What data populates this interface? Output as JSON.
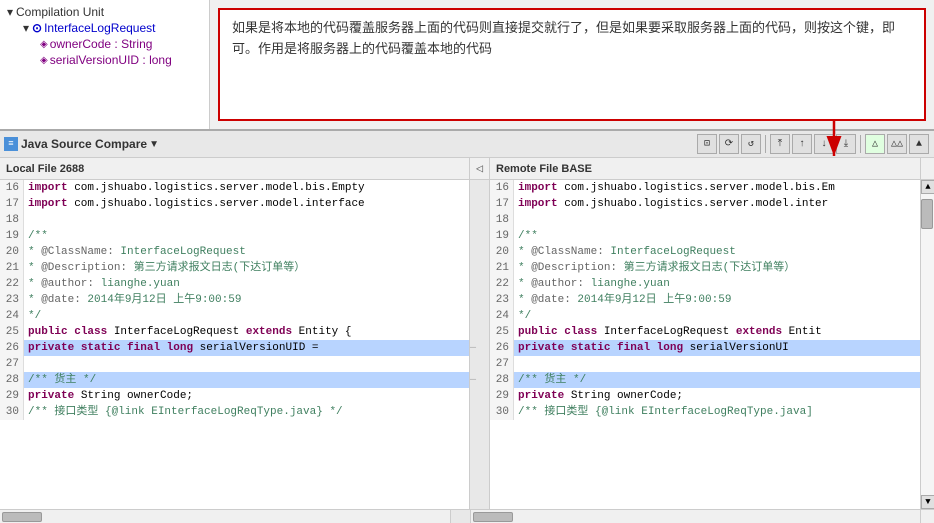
{
  "topPanel": {
    "tree": {
      "root": "Compilation Unit",
      "child": "InterfaceLogRequest",
      "grandchildren": [
        "ownerCode : String",
        "serialVersionUID : long"
      ]
    },
    "callout": "如果是将本地的代码覆盖服务器上面的代码则直接提交就行了，但是如果要采取服务器上面的代码，则按这个键，即可。作用是将服务器上的代码覆盖本地的代码"
  },
  "toolbar": {
    "title": "Java Source Compare",
    "dropdown_label": "▼",
    "buttons": [
      "⊡",
      "↺",
      "↻",
      "⤒",
      "↑",
      "↓",
      "⤓",
      "△",
      "△△",
      "▲"
    ]
  },
  "fileHeaders": {
    "left": "Local File 2688",
    "arrow": "◁",
    "right": "Remote File BASE"
  },
  "leftCode": [
    {
      "num": "16",
      "content": "import com.jshuabo.logistics.server.model.bis.Empty",
      "highlight": false
    },
    {
      "num": "17",
      "content": "import com.jshuabo.logistics.server.model.interface",
      "highlight": false
    },
    {
      "num": "18",
      "content": "",
      "highlight": false
    },
    {
      "num": "19",
      "content": "/**",
      "highlight": false
    },
    {
      "num": "20",
      "content": " * @ClassName: InterfaceLogRequest",
      "highlight": false
    },
    {
      "num": "21",
      "content": " * @Description: 第三方请求报文日志(下达订单等）",
      "highlight": false
    },
    {
      "num": "22",
      "content": " * @author: lianghe.yuan",
      "highlight": false
    },
    {
      "num": "23",
      "content": " * @date: 2014年9月12日 上午9:00:59",
      "highlight": false
    },
    {
      "num": "24",
      "content": " */",
      "highlight": false
    },
    {
      "num": "25",
      "content": "public class InterfaceLogRequest extends Entity {",
      "highlight": false
    },
    {
      "num": "26",
      "content": "    private static final long serialVersionUID =",
      "highlight": true
    },
    {
      "num": "27",
      "content": "",
      "highlight": false
    },
    {
      "num": "28",
      "content": "    /** 货主 */",
      "highlight": true
    },
    {
      "num": "29",
      "content": "    private String ownerCode;",
      "highlight": false
    },
    {
      "num": "30",
      "content": "    /** 接口类型 {@link EInterfaceLogReqType.java} */",
      "highlight": false
    }
  ],
  "rightCode": [
    {
      "num": "16",
      "content": "import com.jshuabo.logistics.server.model.bis.Em",
      "highlight": false
    },
    {
      "num": "17",
      "content": "import com.jshuabo.logistics.server.model.inter",
      "highlight": false
    },
    {
      "num": "18",
      "content": "",
      "highlight": false
    },
    {
      "num": "19",
      "content": "/**",
      "highlight": false
    },
    {
      "num": "20",
      "content": " * @ClassName: InterfaceLogRequest",
      "highlight": false
    },
    {
      "num": "21",
      "content": " * @Description: 第三方请求报文日志(下达订单等）",
      "highlight": false
    },
    {
      "num": "22",
      "content": " * @author: lianghe.yuan",
      "highlight": false
    },
    {
      "num": "23",
      "content": " * @date: 2014年9月12日 上午9:00:59",
      "highlight": false
    },
    {
      "num": "24",
      "content": " */",
      "highlight": false
    },
    {
      "num": "25",
      "content": "public class InterfaceLogRequest extends Entit",
      "highlight": false
    },
    {
      "num": "26",
      "content": "    private static final long serialVersionUI",
      "highlight": true
    },
    {
      "num": "27",
      "content": "",
      "highlight": false
    },
    {
      "num": "28",
      "content": "    /** 货主 */",
      "highlight": true
    },
    {
      "num": "29",
      "content": "    private String ownerCode;",
      "highlight": false
    },
    {
      "num": "30",
      "content": "    /** 接口类型 {@link EInterfaceLogReqType.java]",
      "highlight": false
    }
  ]
}
